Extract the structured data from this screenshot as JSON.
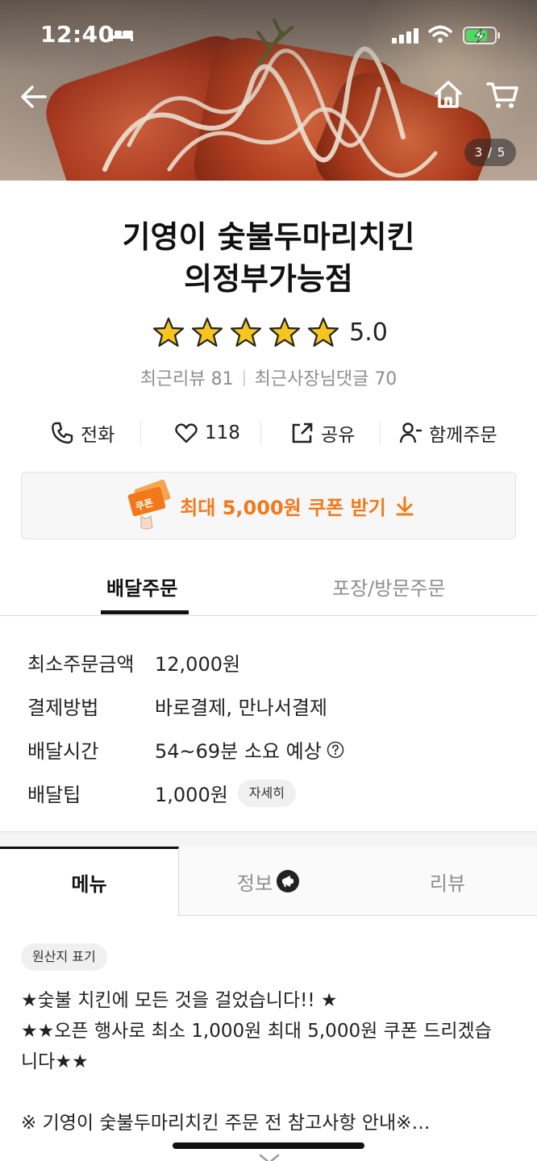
{
  "status_bar": {
    "time": "12:40"
  },
  "hero": {
    "photo_counter": "3 / 5"
  },
  "store": {
    "name_line1": "기영이 숯불두마리치킨",
    "name_line2": "의정부가능점",
    "rating": "5.0",
    "star_count": 5,
    "recent_reviews": "최근리뷰 81",
    "owner_replies": "최근사장님댓글 70"
  },
  "actions": {
    "call": "전화",
    "favorite_count": "118",
    "share": "공유",
    "group_order": "함께주문"
  },
  "coupon": {
    "label": "최대 5,000원 쿠폰 받기",
    "graphic_text": "쿠폰"
  },
  "order_tabs": {
    "delivery": "배달주문",
    "pickup": "포장/방문주문"
  },
  "delivery_info": [
    {
      "label": "최소주문금액",
      "value": "12,000원"
    },
    {
      "label": "결제방법",
      "value": "바로결제, 만나서결제"
    },
    {
      "label": "배달시간",
      "value": "54~69분 소요 예상"
    },
    {
      "label": "배달팁",
      "value": "1,000원",
      "chip": "자세히"
    }
  ],
  "main_tabs": {
    "menu": "메뉴",
    "info": "정보",
    "review": "리뷰"
  },
  "notice": {
    "origin_chip": "원산지 표기",
    "line1": "★숯불 치킨에 모든 것을 걸었습니다!! ★",
    "line2": "★★오픈 행사로 최소 1,000원 최대 5,000원 쿠폰 드리겠습",
    "line3": "니다★★",
    "line4": "※ 기영이 숯불두마리치킨 주문 전 참고사항 안내※…"
  },
  "colors": {
    "accent_orange": "#f2791a",
    "star_yellow": "#f7c51e",
    "text_primary": "#222222",
    "text_muted": "#8e8e8e"
  }
}
